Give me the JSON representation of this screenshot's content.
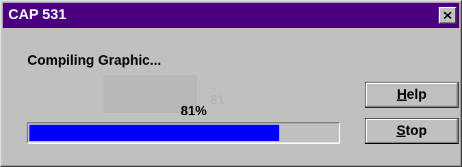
{
  "window": {
    "title": "CAP 531",
    "close_symbol": "×",
    "title_bar_color": "#4b0082"
  },
  "dialog": {
    "message": "Compiling Graphic...",
    "ghost_text": "81",
    "progress_label": "81%",
    "progress_fraction": 0.81,
    "progress_color": "#0000ff"
  },
  "buttons": {
    "help": {
      "mnemonic": "H",
      "rest": "elp"
    },
    "stop": {
      "mnemonic": "S",
      "rest": "top"
    }
  },
  "icons": {
    "close": "close-icon"
  }
}
